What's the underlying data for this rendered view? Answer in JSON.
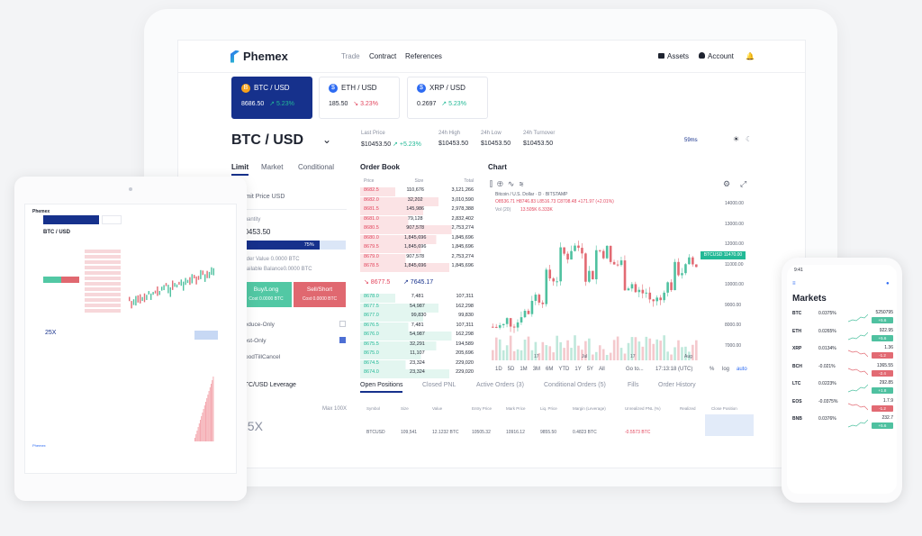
{
  "nav": {
    "logo": "Phemex",
    "trade": "Trade",
    "contract": "Contract",
    "references": "References",
    "assets": "Assets",
    "account": "Account"
  },
  "tickers": [
    {
      "symbol": "BTC / USD",
      "price": "8686.50",
      "change": "↗ 5.23%",
      "icon": "B",
      "icon_color": "#f7a21b"
    },
    {
      "symbol": "ETH / USD",
      "price": "185.50",
      "change": "↘ 3.23%",
      "icon": "$",
      "icon_color": "#2d6bf2"
    },
    {
      "symbol": "XRP / USD",
      "price": "0.2697",
      "change": "↗ 5.23%",
      "icon": "$",
      "icon_color": "#2d6bf2"
    }
  ],
  "pair": "BTC / USD",
  "stats": [
    {
      "label": "Last Price",
      "value": "$10453.50",
      "extra": "↗ +5.23%"
    },
    {
      "label": "24h High",
      "value": "$10453.50"
    },
    {
      "label": "24h Low",
      "value": "$10453.50"
    },
    {
      "label": "24h Turnover",
      "value": "$10453.50"
    }
  ],
  "latency": "59ms",
  "order_tabs": {
    "limit": "Limit",
    "market": "Market",
    "conditional": "Conditional"
  },
  "order_form": {
    "limit_price": "Limit Price USD",
    "quantity": "Quantity",
    "qty_value": "10453.50",
    "pct": "75%",
    "order_value": "Order Value 0.0000 BTC",
    "available": "Available Balance0.0000 BTC",
    "buy": "Buy/Long",
    "buy_cost": "Cost 0.0000 BTC",
    "sell": "Sell/Short",
    "sell_cost": "Cost 0.0000 BTC",
    "reduce": "Reduce-Only",
    "post": "Post-Only",
    "gtc": "GoodTillCancel",
    "leverage": "BTC/USD Leverage",
    "max": "Max 100X",
    "lev_value": "25X"
  },
  "order_book": {
    "title": "Order Book",
    "cols": [
      "Price",
      "Size",
      "Total"
    ],
    "asks": [
      [
        "8682.5",
        "110,676",
        "3,121,266"
      ],
      [
        "8682.0",
        "32,202",
        "3,010,590"
      ],
      [
        "8681.5",
        "145,986",
        "2,978,388"
      ],
      [
        "8681.0",
        "79,128",
        "2,832,402"
      ],
      [
        "8680.5",
        "907,578",
        "2,753,274"
      ],
      [
        "8680.0",
        "1,845,696",
        "1,845,696"
      ],
      [
        "8679.5",
        "1,845,696",
        "1,845,696"
      ],
      [
        "8679.0",
        "907,578",
        "2,753,274"
      ],
      [
        "8678.5",
        "1,845,696",
        "1,845,696"
      ]
    ],
    "mid": "↘ 8677.5",
    "mark": "↗ 7645.17",
    "bids": [
      [
        "8678.0",
        "7,481",
        "107,311"
      ],
      [
        "8677.5",
        "54,987",
        "162,298"
      ],
      [
        "8677.0",
        "99,830",
        "99,830"
      ],
      [
        "8676.5",
        "7,481",
        "107,311"
      ],
      [
        "8676.0",
        "54,987",
        "162,298"
      ],
      [
        "8675.5",
        "32,291",
        "194,589"
      ],
      [
        "8675.0",
        "11,107",
        "205,696"
      ],
      [
        "8674.5",
        "23,324",
        "229,020"
      ],
      [
        "8674.0",
        "23,324",
        "229,020"
      ]
    ]
  },
  "chart": {
    "title": "Chart",
    "legend": "Bitcoin / U.S. Dollar · D · BITSTAMP",
    "ohlc": "O8536.71 H8746.83 L8516.73 C8708.48 +171.97 (+2.01%)",
    "vol": "Vol (20)",
    "vol_val": "13.505K 6.333K",
    "price_label": "BTCUSD 11470.00",
    "yticks": [
      "14000.00",
      "13000.00",
      "12000.00",
      "11000.00",
      "10000.00",
      "9000.00",
      "8000.00",
      "7000.00"
    ],
    "xticks": [
      "17",
      "Jul",
      "17",
      "Aug"
    ],
    "ranges": [
      "1D",
      "5D",
      "1M",
      "3M",
      "6M",
      "YTD",
      "1Y",
      "5Y",
      "All"
    ],
    "goto": "Go to...",
    "time": "17:13:18 (UTC)",
    "pct": "%",
    "log": "log",
    "auto": "auto"
  },
  "positions": {
    "tabs": [
      "Open Positions",
      "Closed PNL",
      "Active Orders (3)",
      "Conditional Orders (5)",
      "Fills",
      "Order History"
    ],
    "cols": [
      "Symbol",
      "Size",
      "Value",
      "Entry Price",
      "Mark Price",
      "Liq. Price",
      "Margin (Leverage)",
      "Unrealized PNL (%)",
      "Realized",
      "Close Position"
    ],
    "row": [
      "BTCUSD",
      "109,541",
      "12.1232 BTC",
      "10505.32",
      "10916.12",
      "9855.50",
      "0.4823 BTC",
      "-0.5573 BTC",
      "",
      "",
      ""
    ]
  },
  "phone": {
    "time": "9:41",
    "title": "Markets",
    "rows": [
      [
        "BTC",
        "0.0375%",
        "5250795",
        "+5.6"
      ],
      [
        "ETH",
        "0.0265%",
        "922.95",
        "+5.6"
      ],
      [
        "XRP",
        "0.0134%",
        "1.36",
        "-1.2"
      ],
      [
        "BCH",
        "-0.021%",
        "1365.55",
        "-2.4"
      ],
      [
        "LTC",
        "0.0223%",
        "292.85",
        "+1.8"
      ],
      [
        "EOS",
        "-0.0375%",
        "1.7.9",
        "-1.2"
      ],
      [
        "BNB",
        "0.0376%",
        "232.7",
        "+5.6"
      ]
    ]
  }
}
